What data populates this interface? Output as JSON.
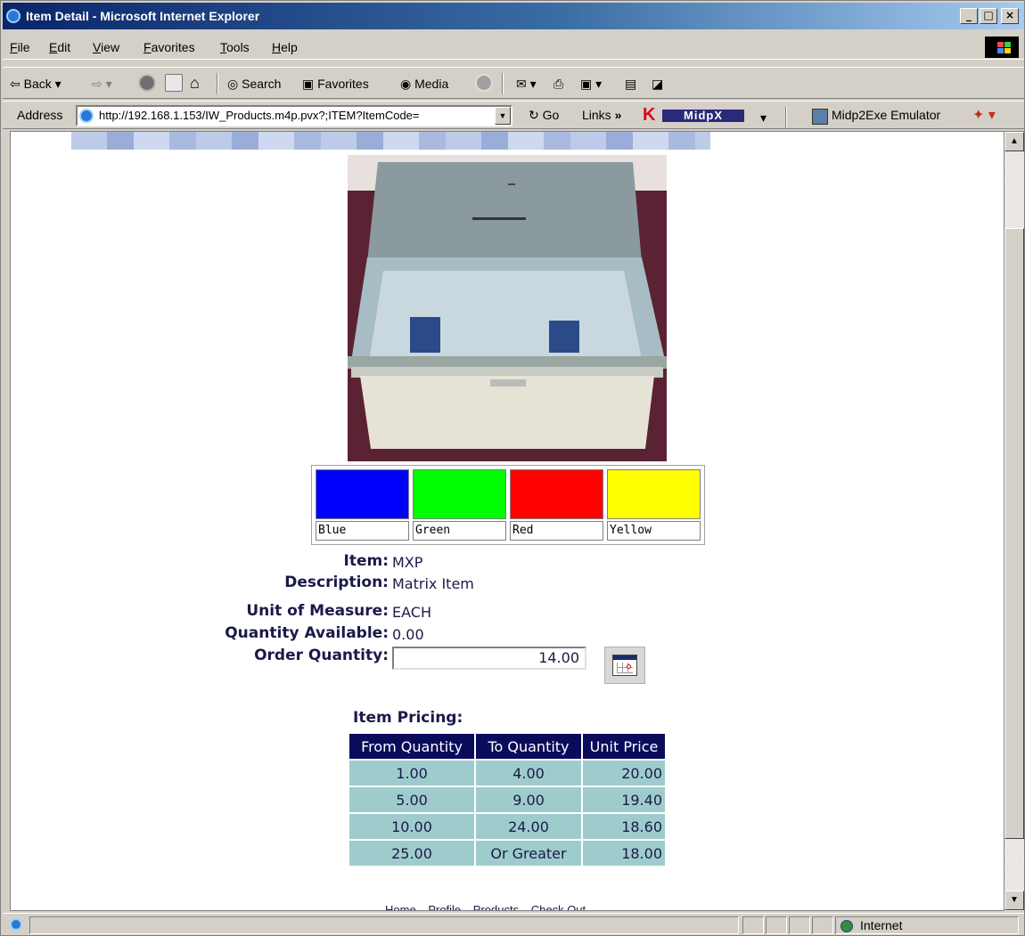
{
  "window": {
    "title": "Item Detail - Microsoft Internet Explorer"
  },
  "menu": [
    "File",
    "Edit",
    "View",
    "Favorites",
    "Tools",
    "Help"
  ],
  "toolbar": {
    "back": "Back",
    "search": "Search",
    "favorites": "Favorites",
    "media": "Media"
  },
  "address": {
    "label": "Address",
    "url": "http://192.168.1.153/IW_Products.m4p.pvx?;ITEM?ItemCode=",
    "go": "Go",
    "links": "Links",
    "links_chevron": "»",
    "midpx": "MidpX",
    "emulator": "Midp2Exe Emulator"
  },
  "swatches": [
    {
      "label": "Blue",
      "color": "#0000ff"
    },
    {
      "label": "Green",
      "color": "#00ff00"
    },
    {
      "label": "Red",
      "color": "#ff0000"
    },
    {
      "label": "Yellow",
      "color": "#ffff00"
    }
  ],
  "item": {
    "item_label": "Item:",
    "item_value": "MXP",
    "description_label": "Description:",
    "description_value": "Matrix Item",
    "uom_label": "Unit of Measure:",
    "uom_value": "EACH",
    "qty_available_label": "Quantity Available:",
    "qty_available_value": "0.00",
    "order_qty_label": "Order Quantity:",
    "order_qty_value": "14.00"
  },
  "pricing": {
    "title": "Item Pricing:",
    "headers": [
      "From Quantity",
      "To Quantity",
      "Unit Price"
    ],
    "rows": [
      [
        "1.00",
        "4.00",
        "20.00"
      ],
      [
        "5.00",
        "9.00",
        "19.40"
      ],
      [
        "10.00",
        "24.00",
        "18.60"
      ],
      [
        "25.00",
        "Or Greater",
        "18.00"
      ]
    ]
  },
  "footer_links": [
    "Home",
    "Profile",
    "Products",
    "Check Out"
  ],
  "status": {
    "zone": "Internet"
  }
}
